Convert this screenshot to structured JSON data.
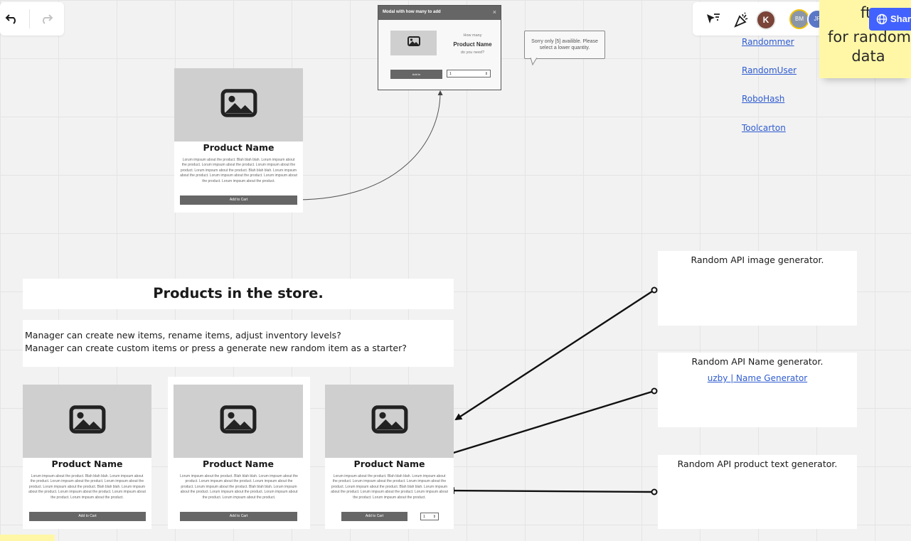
{
  "toolbar": {
    "undo_icon": "undo-icon",
    "redo_icon": "redo-icon",
    "pointer_icon": "cursor-filter-icon",
    "celebrate_icon": "party-popper-icon",
    "avatars": [
      {
        "initial": "K",
        "color": "#7a4438"
      },
      {
        "initial": "BM",
        "color": "#8a96a8"
      },
      {
        "initial": "JF",
        "color": "#5b77c7"
      }
    ],
    "collaborator_count": "2",
    "share_label": "Shar"
  },
  "sticky_top": {
    "lines": [
      "ft",
      "for random",
      "data"
    ]
  },
  "links": {
    "randommer": "Randommer",
    "randomuser": "RandomUser",
    "robohash": "RoboHash",
    "toolcarton": "Toolcarton",
    "uzby": "uzby | Name Generator"
  },
  "modal": {
    "title": "Modal with how many to add",
    "close": "×",
    "line1": "How many",
    "product": "Product Name",
    "line2": "do you need?",
    "button": "Add to",
    "select_value": "1",
    "select_arrow": "⇕"
  },
  "tooltip": {
    "text": "Sorry only [5] availible. Please select a lower quantity."
  },
  "product_card": {
    "name": "Product Name",
    "desc": "Lorum impsum about the product. Blah blah blah. Lorum impsum about the product. Lorum impsum about the product. Lorum impsum about the product. Lorum impsum about the product. Blah blah blah. Lorum impsum about the product. Lorum impsum about the product. Lorum impsum about the product. Lorum impsum about the product.",
    "add_label": "Add to Cart",
    "qty_value": "1",
    "qty_arrow": "⇕"
  },
  "store": {
    "heading": "Products in the store.",
    "desc_line1": "Manager can create new items, rename items, adjust inventory levels?",
    "desc_line2": "Manager can create custom items or press a generate new random item as a starter?"
  },
  "notes": {
    "image_gen": "Random API image generator.",
    "name_gen": "Random API Name generator.",
    "text_gen": "Random API product text generator."
  },
  "colors": {
    "link": "#2e5bd0",
    "share": "#4262ff",
    "sticky": "#fff7a6",
    "image_placeholder": "#cfcfcf",
    "button": "#666666"
  }
}
